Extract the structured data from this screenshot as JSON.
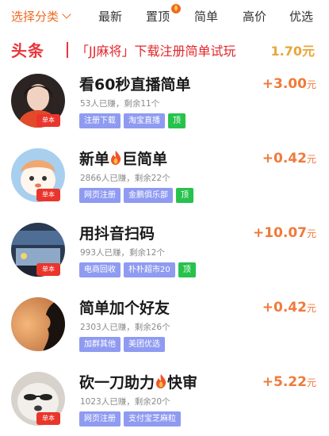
{
  "tabs": [
    {
      "label": "选择分类",
      "active": true
    },
    {
      "label": "最新"
    },
    {
      "label": "置顶"
    },
    {
      "label": "简单"
    },
    {
      "label": "高价"
    },
    {
      "label": "优选"
    }
  ],
  "headline": {
    "tag": "头条",
    "text": "「JJ麻将」下载注册简单试玩",
    "price": "1.70元"
  },
  "items": [
    {
      "title": "看60秒直播简单",
      "stats": "53人已赚，剩余11个",
      "tags": [
        "注册下载",
        "淘宝直播",
        "顶"
      ],
      "reward_amount": "+3.00",
      "reward_unit": "元",
      "avatar_badge": "单本"
    },
    {
      "title_pre": "新单",
      "title_post": "巨简单",
      "stats": "2866人已赚，剩余22个",
      "tags": [
        "网页注册",
        "金鹏俱乐部",
        "顶"
      ],
      "reward_amount": "+0.42",
      "reward_unit": "元",
      "avatar_badge": "单本"
    },
    {
      "title": "用抖音扫码",
      "stats": "993人已赚，剩余12个",
      "tags": [
        "电商回收",
        "朴朴超市20",
        "顶"
      ],
      "reward_amount": "+10.07",
      "reward_unit": "元",
      "avatar_badge": "单本"
    },
    {
      "title": "简单加个好友",
      "stats": "2303人已赚，剩余26个",
      "tags": [
        "加群其他",
        "美团优选"
      ],
      "reward_amount": "+0.42",
      "reward_unit": "元"
    },
    {
      "title_pre": "砍一刀助力",
      "title_post": "快审",
      "stats": "1023人已赚，剩余20个",
      "tags": [
        "网页注册",
        "支付宝芝麻粒"
      ],
      "reward_amount": "+5.22",
      "reward_unit": "元",
      "avatar_badge": "单本"
    }
  ],
  "colors": {
    "accent": "#f06a22",
    "headline_red": "#e2262b",
    "tag_blue": "#8f9bf1",
    "tag_green": "#27c24c",
    "reward": "#f07a3a"
  }
}
